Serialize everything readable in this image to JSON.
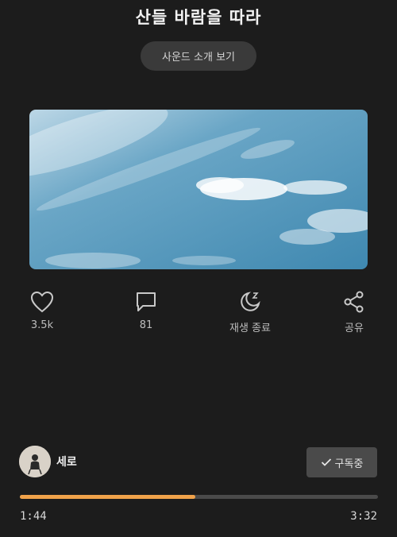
{
  "header": {
    "title": "산들 바람을 따라",
    "intro_button": "사운드 소개 보기"
  },
  "artwork": {
    "description_icon": "sky-clouds-image"
  },
  "actions": [
    {
      "label": "3.5k",
      "icon": "heart-icon"
    },
    {
      "label": "81",
      "icon": "comment-icon"
    },
    {
      "label": "재생 종료",
      "icon": "sleep-moon-icon"
    },
    {
      "label": "공유",
      "icon": "share-icon"
    }
  ],
  "creator": {
    "name": "세로",
    "subscribe_label": "구독중"
  },
  "player": {
    "current_time": "1:44",
    "total_time": "3:32",
    "progress": 0.49,
    "accent_color": "#f0a24a"
  }
}
